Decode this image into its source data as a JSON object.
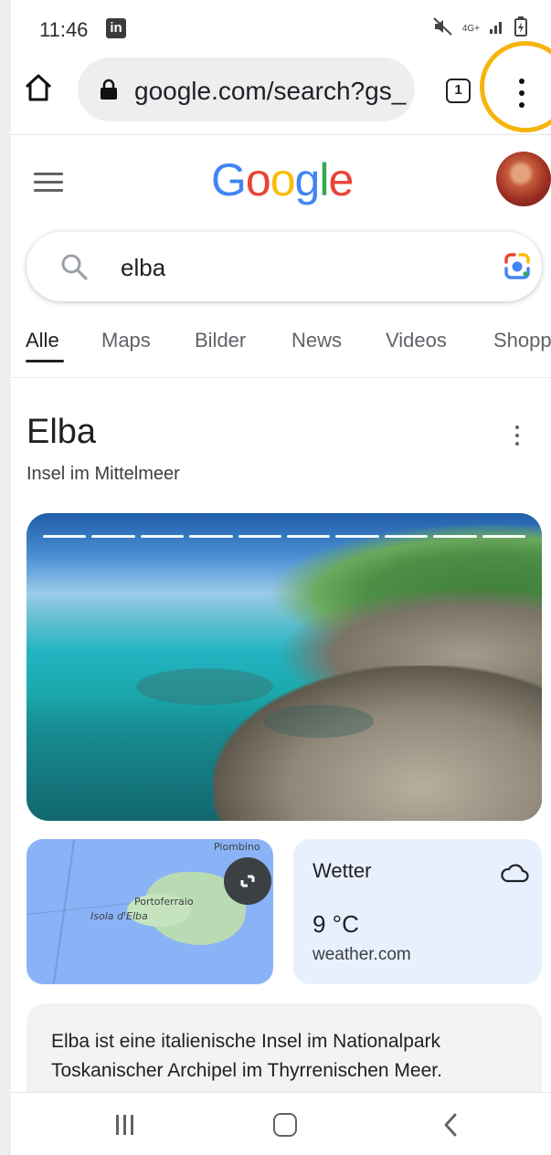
{
  "status_bar": {
    "time": "11:46",
    "app_badge": "in",
    "network": "4G+"
  },
  "browser": {
    "url": "google.com/search?gs_",
    "tab_count": "1"
  },
  "google": {
    "logo": [
      "G",
      "o",
      "o",
      "g",
      "l",
      "e"
    ],
    "search_query": "elba",
    "tabs": [
      "Alle",
      "Maps",
      "Bilder",
      "News",
      "Videos",
      "Shopp"
    ],
    "active_tab": "Alle"
  },
  "knowledge_panel": {
    "title": "Elba",
    "subtitle": "Insel im Mittelmeer",
    "map_labels": {
      "piombino": "Piombino",
      "portoferraio": "Portoferraio",
      "isola": "Isola d'Elba"
    },
    "weather": {
      "title": "Wetter",
      "temperature": "9 °C",
      "source": "weather.com"
    },
    "description_line1": "Elba ist eine italienische Insel im Nationalpark",
    "description_line2": "Toskanischer Archipel im Thyrrenischen Meer."
  },
  "colors": {
    "accent_ring": "#f6b40b",
    "google_blue": "#4285f4",
    "google_red": "#ea4335",
    "google_yellow": "#fbbc05",
    "google_green": "#34a853"
  },
  "icons": [
    "linkedin-icon",
    "mute-icon",
    "signal-icon",
    "battery-icon",
    "home-icon",
    "lock-icon",
    "tab-switcher-icon",
    "more-vert-icon",
    "hamburger-menu-icon",
    "search-icon",
    "google-lens-icon",
    "cloud-icon",
    "expand-icon",
    "recent-apps-icon",
    "home-nav-icon",
    "back-icon"
  ]
}
